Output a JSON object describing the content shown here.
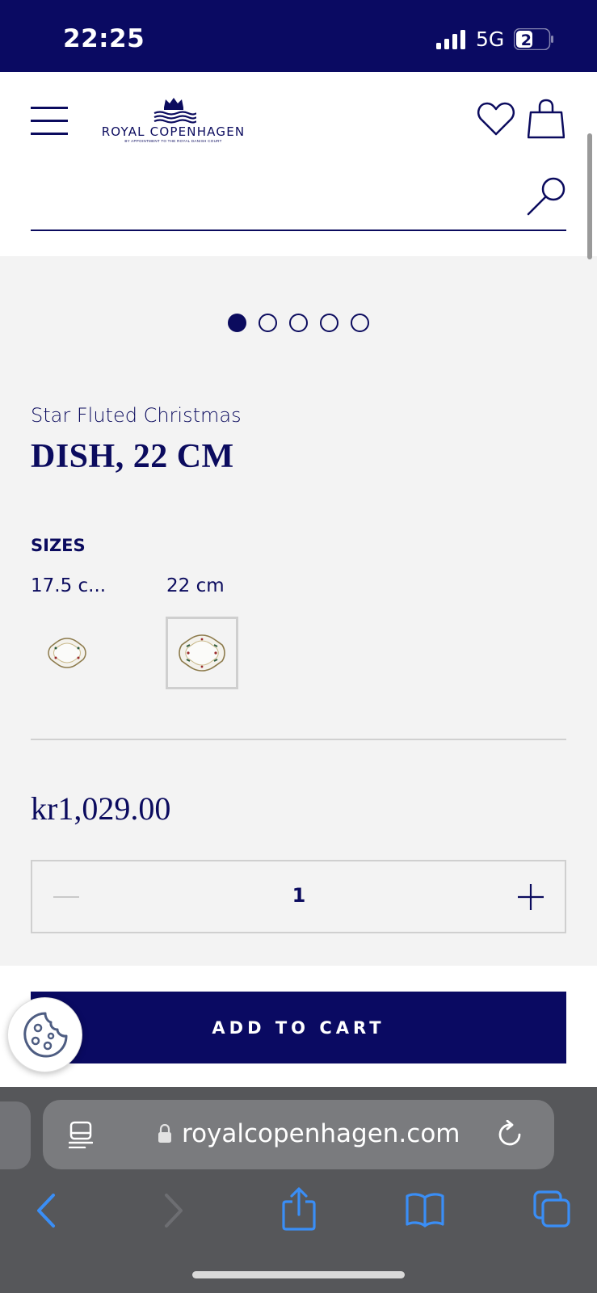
{
  "status_bar": {
    "time": "22:25",
    "network": "5G",
    "battery": "21"
  },
  "header": {
    "logo": {
      "name": "ROYAL COPENHAGEN",
      "tagline": "BY APPOINTMENT TO THE ROYAL DANISH COURT"
    },
    "search_value": "",
    "icons": [
      "hamburger-menu-icon",
      "heart-icon",
      "shopping-bag-icon",
      "search-icon"
    ]
  },
  "carousel": {
    "total_slides": 5,
    "active_index": 0
  },
  "product": {
    "collection": "Star Fluted Christmas",
    "title": "DISH, 22 CM",
    "sizes_label": "SIZES",
    "sizes": [
      {
        "label": "17.5 c...",
        "selected": false
      },
      {
        "label": "22 cm",
        "selected": true
      }
    ],
    "price": "kr1,029.00",
    "quantity": "1"
  },
  "cta": {
    "add_to_cart": "ADD TO CART"
  },
  "browser": {
    "url": "royalcopenhagen.com"
  },
  "colors": {
    "brand_navy": "#0a0a62",
    "page_bg": "#f3f3f3",
    "browser_accent": "#3a8ef6"
  }
}
